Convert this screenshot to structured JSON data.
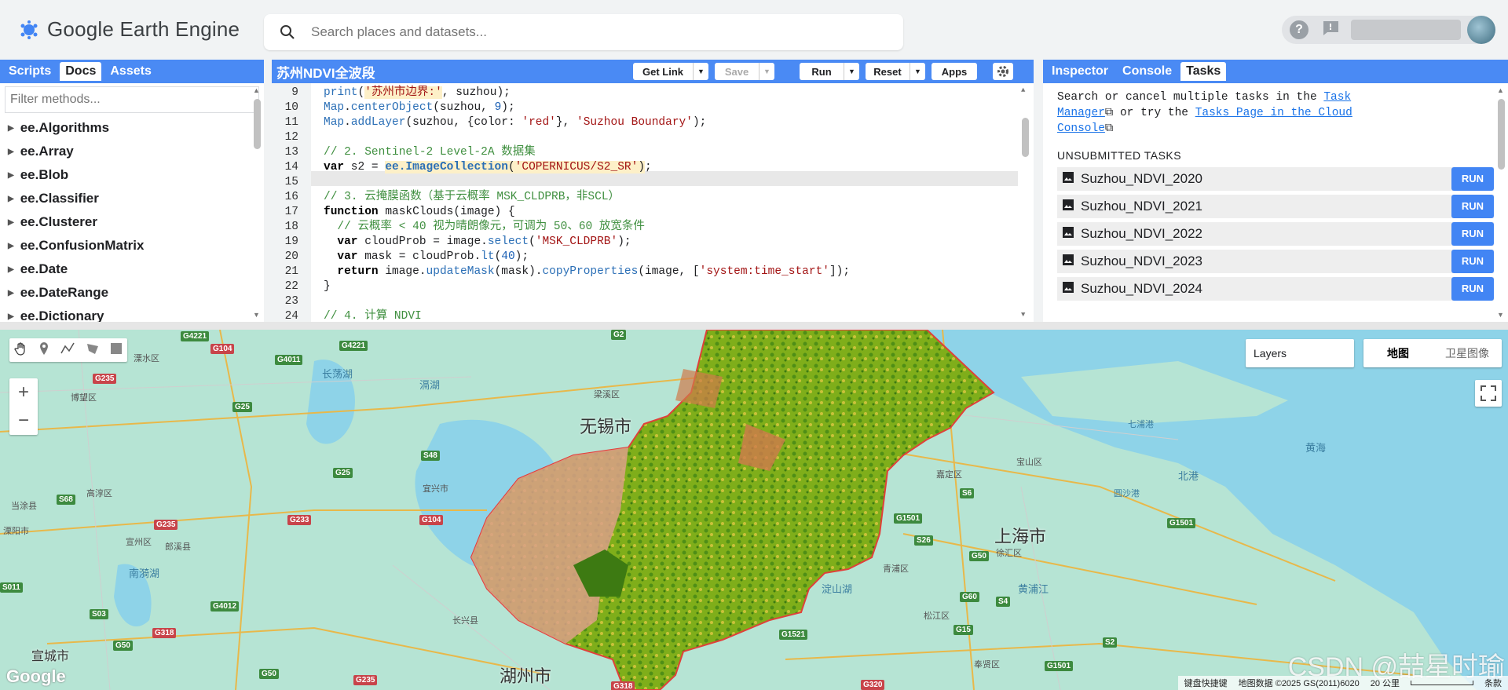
{
  "app": {
    "title": "Google Earth Engine"
  },
  "search": {
    "placeholder": "Search places and datasets..."
  },
  "left_panel": {
    "tabs": [
      "Scripts",
      "Docs",
      "Assets"
    ],
    "active_tab": "Docs",
    "filter_placeholder": "Filter methods...",
    "items": [
      "ee.Algorithms",
      "ee.Array",
      "ee.Blob",
      "ee.Classifier",
      "ee.Clusterer",
      "ee.ConfusionMatrix",
      "ee.Date",
      "ee.DateRange",
      "ee.Dictionary"
    ]
  },
  "editor": {
    "script_title": "苏州NDVI全波段",
    "buttons": {
      "get_link": "Get Link",
      "save": "Save",
      "run": "Run",
      "reset": "Reset",
      "apps": "Apps"
    },
    "line_numbers": [
      "9",
      "10",
      "11",
      "12",
      "13",
      "14",
      "15",
      "16",
      "17",
      "18",
      "19",
      "20",
      "21",
      "22",
      "23",
      "24"
    ],
    "active_line": "15"
  },
  "right_panel": {
    "tabs": [
      "Inspector",
      "Console",
      "Tasks"
    ],
    "active_tab": "Tasks",
    "intro_1": "Search or cancel multiple tasks in the ",
    "link_1": "Task Manager",
    "intro_2": " or try the ",
    "link_2": "Tasks Page in the Cloud Console",
    "unsubmitted_title": "UNSUBMITTED TASKS",
    "tasks": [
      {
        "name": "Suzhou_NDVI_2020",
        "action": "RUN"
      },
      {
        "name": "Suzhou_NDVI_2021",
        "action": "RUN"
      },
      {
        "name": "Suzhou_NDVI_2022",
        "action": "RUN"
      },
      {
        "name": "Suzhou_NDVI_2023",
        "action": "RUN"
      },
      {
        "name": "Suzhou_NDVI_2024",
        "action": "RUN"
      }
    ]
  },
  "map": {
    "layers_label": "Layers",
    "map_types": [
      "地图",
      "卫星图像"
    ],
    "selected_map_type": "地图",
    "zoom_in": "+",
    "zoom_out": "−",
    "cities": [
      "无锡市",
      "上海市",
      "湖州市",
      "宣城市"
    ],
    "districts": [
      "溧水区",
      "博望区",
      "溧阳市",
      "梁溪区",
      "宜兴市",
      "宝山区",
      "嘉定区",
      "七浦港",
      "黄海",
      "北港",
      "圆沙港",
      "高淳区",
      "宣州区",
      "郎溪县",
      "青浦区",
      "徐汇区",
      "松江区",
      "长兴县",
      "奉贤区",
      "当涂县",
      "溧阳",
      "长荡湖",
      "滆湖",
      "南漪湖",
      "淀山湖",
      "黄浦江"
    ],
    "shields": [
      "G4221",
      "G104",
      "G4221",
      "G4011",
      "G2",
      "G235",
      "G25",
      "G25",
      "S48",
      "G104",
      "G1501",
      "S26",
      "S6",
      "G1501",
      "S68",
      "G235",
      "G233",
      "G50",
      "G60",
      "S4",
      "G1521",
      "G15",
      "S03",
      "G4012",
      "G318",
      "G50",
      "G50",
      "G318",
      "G235",
      "G320",
      "S2",
      "G1501",
      "S011"
    ],
    "attribution": {
      "shortcuts": "键盘快捷键",
      "data": "地图数据 ©2025 GS(2011)6020",
      "scale": "20 公里",
      "terms": "条款"
    },
    "google_logo": "Google",
    "watermark": "CSDN @喆星时瑜"
  },
  "colors": {
    "accent": "#4a8af4",
    "run_button": "#4285f4",
    "boundary": "#e0403a",
    "water": "#8ed3e8",
    "land": "#b6e4d4"
  }
}
